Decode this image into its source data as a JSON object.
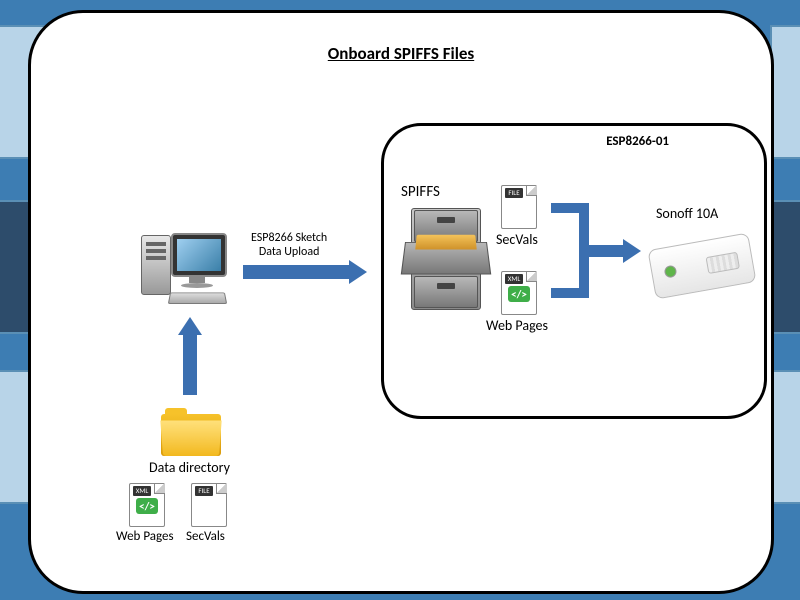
{
  "title": "Onboard  SPIFFS Files",
  "inner_title": "ESP8266-01",
  "upload_label": "ESP8266 Sketch\nData Upload",
  "spiffs_label": "SPIFFS",
  "secvals_label": "SecVals",
  "webpages_label": "Web Pages",
  "sonoff_label": "Sonoff 10A",
  "data_dir_label": "Data directory",
  "left_webpages_label": "Web Pages",
  "left_secvals_label": "SecVals",
  "xml_tag": "</>",
  "file_hdr_xml": "XML",
  "file_hdr_file": "FILE"
}
